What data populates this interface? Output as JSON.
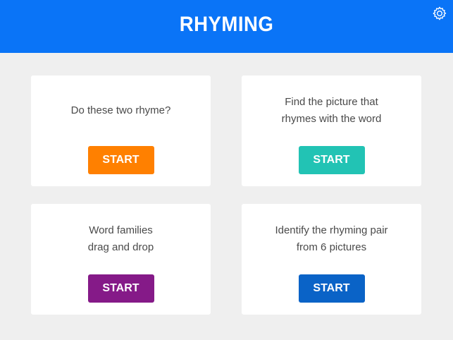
{
  "header": {
    "title": "RHYMING",
    "settings_icon": "gear-icon",
    "background": "#0a74f7"
  },
  "activities": [
    {
      "description": "Do these two rhyme?",
      "start_label": "START",
      "button_color": "#ff8000"
    },
    {
      "description": "Find the picture that\nrhymes with the word",
      "start_label": "START",
      "button_color": "#22c3b4"
    },
    {
      "description": "Word families\ndrag and drop",
      "start_label": "START",
      "button_color": "#851a88"
    },
    {
      "description": "Identify the rhyming pair\nfrom 6 pictures",
      "start_label": "START",
      "button_color": "#0a63c7"
    }
  ]
}
